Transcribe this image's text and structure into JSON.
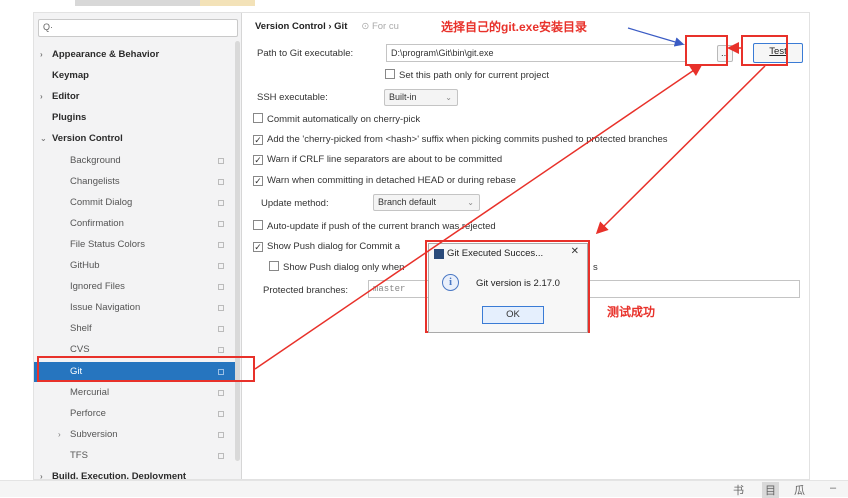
{
  "search": {
    "placeholder": "Q·"
  },
  "sidebar": {
    "items": [
      {
        "label": "Appearance & Behavior",
        "arrow": "›",
        "level": 0
      },
      {
        "label": "Keymap",
        "arrow": "",
        "level": 0
      },
      {
        "label": "Editor",
        "arrow": "›",
        "level": 0
      },
      {
        "label": "Plugins",
        "arrow": "",
        "level": 0
      },
      {
        "label": "Version Control",
        "arrow": "⌄",
        "level": 0
      },
      {
        "label": "Background",
        "level": 1
      },
      {
        "label": "Changelists",
        "level": 1
      },
      {
        "label": "Commit Dialog",
        "level": 1
      },
      {
        "label": "Confirmation",
        "level": 1
      },
      {
        "label": "File Status Colors",
        "level": 1
      },
      {
        "label": "GitHub",
        "level": 1
      },
      {
        "label": "Ignored Files",
        "level": 1
      },
      {
        "label": "Issue Navigation",
        "level": 1
      },
      {
        "label": "Shelf",
        "level": 1
      },
      {
        "label": "CVS",
        "level": 1
      },
      {
        "label": "Git",
        "level": 1,
        "selected": true
      },
      {
        "label": "Mercurial",
        "level": 1
      },
      {
        "label": "Perforce",
        "level": 1
      },
      {
        "label": "Subversion",
        "level": 1,
        "arrow": "›"
      },
      {
        "label": "TFS",
        "level": 1
      },
      {
        "label": "Build, Execution, Deployment",
        "arrow": "›",
        "level": 0
      }
    ]
  },
  "main": {
    "breadcrumb": "Version Control  ›  Git",
    "breadcrumb_muted": "⊙ For cu",
    "path_label": "Path to Git executable:",
    "path_value": "D:\\program\\Git\\bin\\git.exe",
    "browse_label": "...",
    "test_label": "Test",
    "set_path_label": "Set this path only for current project",
    "ssh_label": "SSH executable:",
    "ssh_value": "Built-in",
    "cb_commit_cherry": "Commit automatically on cherry-pick",
    "cb_add_suffix": "Add the 'cherry-picked from <hash>' suffix when picking commits pushed to protected branches",
    "cb_warn_crlf": "Warn if CRLF line separators are about to be committed",
    "cb_warn_detached": "Warn when committing in detached HEAD or during rebase",
    "update_label": "Update method:",
    "update_value": "Branch default",
    "cb_auto_update": "Auto-update if push of the current branch was rejected",
    "cb_show_push": "Show Push dialog for Commit a",
    "cb_show_push_only": "Show Push dialog only when",
    "cb_show_push_only_tail": "s",
    "protected_label": "Protected branches:",
    "protected_value": "master"
  },
  "annotations": {
    "choose_dir": "选择自己的git.exe安装目录",
    "test_success": "测试成功"
  },
  "dialog": {
    "title": "Git Executed Succes...",
    "close": "✕",
    "info_icon": "i",
    "message": "Git version is 2.17.0",
    "ok_label": "OK"
  },
  "statusbar": {
    "icons": [
      "书",
      "目",
      "瓜",
      "–"
    ]
  },
  "colors": {
    "accent": "#2675bf",
    "annotation": "#e8312a"
  }
}
